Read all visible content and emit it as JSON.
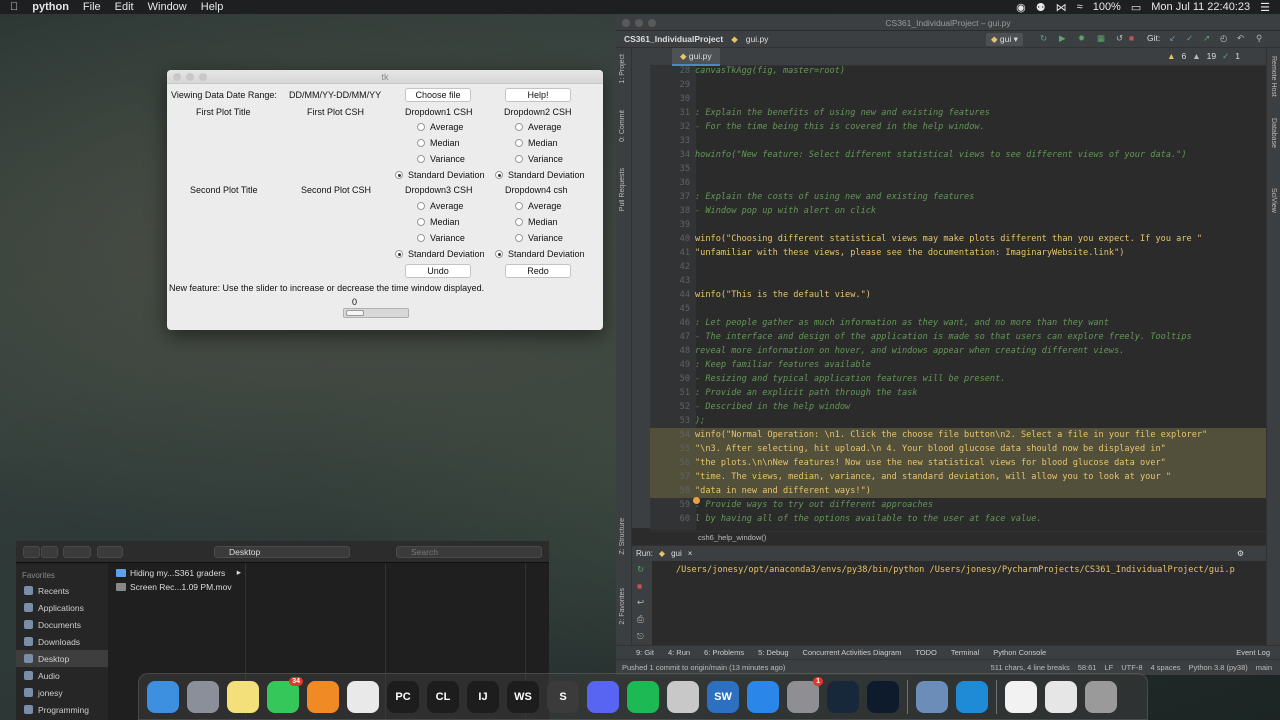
{
  "menubar": {
    "app_name": "python",
    "items": [
      "File",
      "Edit",
      "Window",
      "Help"
    ],
    "battery": "100%",
    "datetime": "Mon Jul 11  22:40:23"
  },
  "tk_window": {
    "title": "tk",
    "date_range_label": "Viewing Data Date Range:",
    "date_range_value": "DD/MM/YY-DD/MM/YY",
    "choose_file": "Choose file",
    "help": "Help!",
    "first_plot_title": "First Plot Title",
    "first_plot_csh": "First Plot CSH",
    "dropdown1": "Dropdown1 CSH",
    "dropdown2": "Dropdown2 CSH",
    "second_plot_title": "Second Plot Title",
    "second_plot_csh": "Second Plot CSH",
    "dropdown3": "Dropdown3 CSH",
    "dropdown4": "Dropdown4 csh",
    "options": [
      "Average",
      "Median",
      "Variance",
      "Standard Deviation"
    ],
    "undo": "Undo",
    "redo": "Redo",
    "feature_text": "New feature: Use the slider to increase or decrease the time window displayed.",
    "slider_value": "0"
  },
  "finder": {
    "location": "Desktop",
    "search_placeholder": "Search",
    "favorites_header": "Favorites",
    "sidebar": [
      "Recents",
      "Applications",
      "Documents",
      "Downloads",
      "Desktop",
      "Audio",
      "jonesy",
      "Programming"
    ],
    "active_sidebar": "Desktop",
    "files": [
      "Hiding my...S361 graders",
      "Screen Rec...1.09 PM.mov"
    ]
  },
  "pycharm": {
    "window_title": "CS361_IndividualProject – gui.py",
    "project": "CS361_IndividualProject",
    "file_tab": "gui.py",
    "run_config": "gui",
    "git_label": "Git:",
    "warnings": "6",
    "weak_warnings": "19",
    "typos": "1",
    "left_tabs": [
      "1: Project",
      "0: Commit",
      "Pull Requests",
      "Z: Structure",
      "2: Favorites"
    ],
    "right_tabs": [
      "Remote Host",
      "Database",
      "SciView"
    ],
    "code_lines": [
      {
        "n": "28",
        "t": "canvasTkAgg(fig, master=root)",
        "style": "comment"
      },
      {
        "n": "29",
        "t": "",
        "style": "comment"
      },
      {
        "n": "30",
        "t": "",
        "style": "comment"
      },
      {
        "n": "31",
        "t": ": Explain the benefits of using new and existing features",
        "style": "comment"
      },
      {
        "n": "32",
        "t": "  - For the time being this is covered in the help window.",
        "style": "comment"
      },
      {
        "n": "33",
        "t": "",
        "style": "comment"
      },
      {
        "n": "34",
        "t": "howinfo(\"New feature: Select different statistical views to see different views of your data.\")",
        "style": "comment"
      },
      {
        "n": "35",
        "t": "",
        "style": "comment"
      },
      {
        "n": "36",
        "t": "",
        "style": "comment"
      },
      {
        "n": "37",
        "t": ": Explain the costs of using new and existing features",
        "style": "comment"
      },
      {
        "n": "38",
        "t": "  - Window pop up with alert on click",
        "style": "comment"
      },
      {
        "n": "39",
        "t": "",
        "style": "comment"
      },
      {
        "n": "40",
        "t": "winfo(\"Choosing different statistical views may make plots different than you expect. If you are \"",
        "style": "str"
      },
      {
        "n": "41",
        "t": "     \"unfamiliar with these views, please see the documentation: ImaginaryWebsite.link\")",
        "style": "str"
      },
      {
        "n": "42",
        "t": "",
        "style": "comment"
      },
      {
        "n": "43",
        "t": "",
        "style": "comment"
      },
      {
        "n": "44",
        "t": "winfo(\"This is the default view.\")",
        "style": "str"
      },
      {
        "n": "45",
        "t": "",
        "style": "comment"
      },
      {
        "n": "46",
        "t": ": Let people gather as much information as they want, and no more than they want",
        "style": "comment"
      },
      {
        "n": "47",
        "t": "  - The interface and design of the application is made so that users can explore freely. Tooltips",
        "style": "comment"
      },
      {
        "n": "48",
        "t": "      reveal more information on hover, and windows appear when creating different views.",
        "style": "comment"
      },
      {
        "n": "49",
        "t": ": Keep familiar features available",
        "style": "comment"
      },
      {
        "n": "50",
        "t": "  - Resizing and typical application features will be present.",
        "style": "comment"
      },
      {
        "n": "51",
        "t": ": Provide an explicit path through the task",
        "style": "comment"
      },
      {
        "n": "52",
        "t": "  - Described in the help window",
        "style": "comment"
      },
      {
        "n": "53",
        "t": ");",
        "style": "comment"
      },
      {
        "n": "54",
        "t": "winfo(\"Normal Operation: \\n1. Click the choose file button\\n2. Select a file in your file explorer\"",
        "style": "hl"
      },
      {
        "n": "55",
        "t": "      \"\\n3. After selecting, hit upload.\\n 4. Your blood glucose data should now be displayed in\"",
        "style": "hl"
      },
      {
        "n": "56",
        "t": "      \"the plots.\\n\\nNew features! Now use the new statistical views for blood glucose data over\"",
        "style": "hl"
      },
      {
        "n": "57",
        "t": "      \"time. The views, median, variance, and standard deviation, will allow you to look at your \"",
        "style": "hl"
      },
      {
        "n": "58",
        "t": "      \"data in new and different ways!\")",
        "style": "hl"
      },
      {
        "n": "59",
        "t": ": Provide ways to try out different approaches",
        "style": "comment"
      },
      {
        "n": "60",
        "t": "l by having all of the options available to the user at face value.",
        "style": "comment"
      }
    ],
    "breadcrumb_hint": "csh6_help_window()",
    "run_label": "Run:",
    "run_tab": "gui",
    "run_output": "/Users/jonesy/opt/anaconda3/envs/py38/bin/python /Users/jonesy/PycharmProjects/CS361_IndividualProject/gui.p",
    "tool_windows": [
      "9: Git",
      "4: Run",
      "6: Problems",
      "5: Debug",
      "Concurrent Activities Diagram",
      "TODO",
      "Terminal",
      "Python Console",
      "Event Log"
    ],
    "status_left": "Pushed 1 commit to origin/main (13 minutes ago)",
    "status_right": [
      "511 chars, 4 line breaks",
      "58:61",
      "LF",
      "UTF-8",
      "4 spaces",
      "Python 3.8 (py38)",
      "main"
    ]
  },
  "dock": {
    "apps": [
      {
        "name": "finder-icon",
        "label": "",
        "color": "#3d8fe0"
      },
      {
        "name": "launchpad-icon",
        "label": "",
        "color": "#8a8f99"
      },
      {
        "name": "notes-icon",
        "label": "",
        "color": "#f4e07a"
      },
      {
        "name": "messages-icon",
        "label": "",
        "color": "#35c759",
        "badge": "34"
      },
      {
        "name": "books-icon",
        "label": "",
        "color": "#f08a24"
      },
      {
        "name": "chrome-icon",
        "label": "",
        "color": "#e9e9e9"
      },
      {
        "name": "pycharm-icon",
        "label": "PC",
        "color": "#1d1d1d"
      },
      {
        "name": "clion-icon",
        "label": "CL",
        "color": "#1d1d1d"
      },
      {
        "name": "intellij-icon",
        "label": "IJ",
        "color": "#1d1d1d"
      },
      {
        "name": "webstorm-icon",
        "label": "WS",
        "color": "#1d1d1d"
      },
      {
        "name": "sublime-icon",
        "label": "S",
        "color": "#3b3b3b"
      },
      {
        "name": "discord-icon",
        "label": "",
        "color": "#5865f2"
      },
      {
        "name": "spotify-icon",
        "label": "",
        "color": "#1db954"
      },
      {
        "name": "disk-utility-icon",
        "label": "",
        "color": "#c8c8c8"
      },
      {
        "name": "solidworks-icon",
        "label": "SW",
        "color": "#2d6fc0"
      },
      {
        "name": "xcode-instruments-icon",
        "label": "",
        "color": "#2a86e8"
      },
      {
        "name": "system-preferences-icon",
        "label": "",
        "color": "#8e8e93",
        "badge": "1"
      },
      {
        "name": "league-icon",
        "label": "",
        "color": "#16283a"
      },
      {
        "name": "league-client-icon",
        "label": "",
        "color": "#0e1b2c"
      },
      {
        "name": "preview-icon",
        "label": "",
        "color": "#6b8db8"
      },
      {
        "name": "edge-icon",
        "label": "",
        "color": "#1f8ad6"
      },
      {
        "name": "document-icon",
        "label": "",
        "color": "#f2f2f2"
      },
      {
        "name": "downloads-stack-icon",
        "label": "",
        "color": "#e6e6e6"
      },
      {
        "name": "trash-icon",
        "label": "",
        "color": "#9a9a9a"
      }
    ]
  }
}
